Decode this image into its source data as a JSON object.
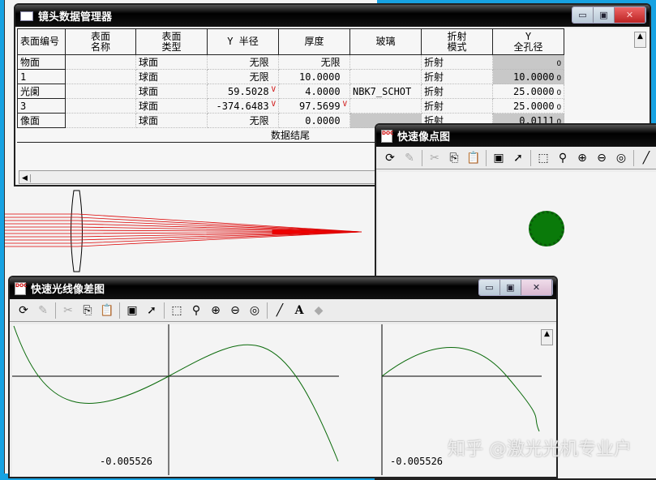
{
  "lens_data": {
    "title": "镜头数据管理器",
    "headers": [
      "表面编号",
      "表面\n名称",
      "表面\n类型",
      "Y 半径",
      "厚度",
      "玻璃",
      "折射\n模式",
      "Y\n全孔径"
    ],
    "rows": [
      [
        "物面",
        "",
        "球面",
        "无限",
        "无限",
        "",
        "折射",
        ""
      ],
      [
        "1",
        "",
        "球面",
        "无限",
        "10.0000",
        "",
        "折射",
        "10.0000"
      ],
      [
        "光阑",
        "",
        "球面",
        "59.5028",
        "4.0000",
        "NBK7_SCHOT",
        "折射",
        "25.0000"
      ],
      [
        "3",
        "",
        "球面",
        "-374.6483",
        "97.5699",
        "",
        "折射",
        "25.0000"
      ],
      [
        "像面",
        "",
        "球面",
        "无限",
        "0.0000",
        "",
        "折射",
        "0.0111"
      ]
    ],
    "solve_marker": "V",
    "aperture_marker": "O",
    "end_label": "数据结尾"
  },
  "spot": {
    "title": "快速像点图",
    "spot_color": "#0a7a0a"
  },
  "fan": {
    "title": "快速光线像差图",
    "scale_left": "-0.005526",
    "scale_right": "-0.005526",
    "curve_color": "#0a6a0a"
  },
  "watermark": "知乎 @激光光机专业户"
}
